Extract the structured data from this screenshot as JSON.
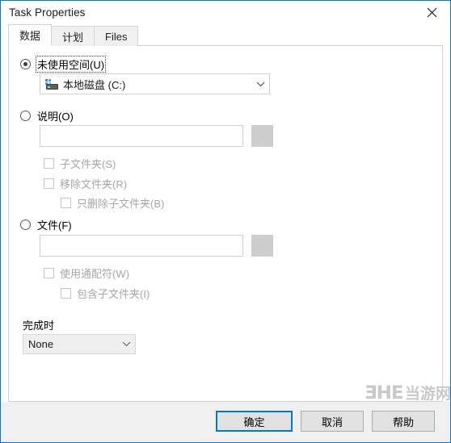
{
  "window": {
    "title": "Task Properties",
    "close_icon": "close-icon",
    "accent_color": "#0078d7"
  },
  "tabs": [
    {
      "label": "数据",
      "active": true
    },
    {
      "label": "计划",
      "active": false
    },
    {
      "label": "Files",
      "active": false
    }
  ],
  "panel": {
    "unused_space": {
      "radio_label": "未使用空间(U)",
      "selected": true,
      "drive_combo": {
        "value": "本地磁盘 (C:)",
        "icon": "hard-drive-icon",
        "arrow_icon": "chevron-down-icon"
      }
    },
    "description": {
      "radio_label": "说明(O)",
      "selected": false,
      "input_value": "",
      "input_placeholder": "",
      "browse_label": "...",
      "checkboxes": [
        {
          "label": "子文件夹(S)",
          "checked": false,
          "disabled": true,
          "indent": 0
        },
        {
          "label": "移除文件夹(R)",
          "checked": false,
          "disabled": true,
          "indent": 0
        },
        {
          "label": "只删除子文件夹(B)",
          "checked": false,
          "disabled": true,
          "indent": 1
        }
      ]
    },
    "files": {
      "radio_label": "文件(F)",
      "selected": false,
      "input_value": "",
      "input_placeholder": "",
      "browse_label": "...",
      "checkboxes": [
        {
          "label": "使用通配符(W)",
          "checked": false,
          "disabled": true,
          "indent": 0
        },
        {
          "label": "包含子文件夹(I)",
          "checked": false,
          "disabled": true,
          "indent": 1
        }
      ]
    },
    "on_complete": {
      "label": "完成时",
      "value": "None",
      "arrow_icon": "chevron-down-icon",
      "disabled": true
    }
  },
  "footer": {
    "ok_label": "确定",
    "cancel_label": "取消",
    "help_label": "帮助"
  },
  "watermark": {
    "logo": "ƎHE",
    "text": "当游网"
  }
}
